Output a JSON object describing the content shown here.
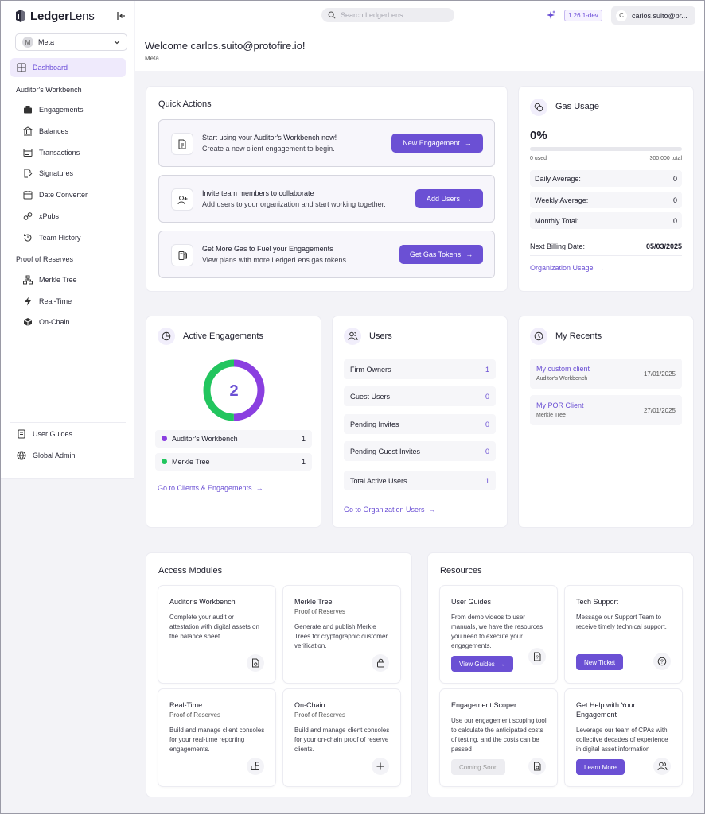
{
  "app": {
    "name_bold": "Ledger",
    "name_rest": "Lens"
  },
  "org_selector": {
    "initial": "M",
    "name": "Meta"
  },
  "nav": {
    "dashboard": "Dashboard",
    "section_auditor": "Auditor's Workbench",
    "auditor_items": [
      "Engagements",
      "Balances",
      "Transactions",
      "Signatures",
      "Date Converter",
      "xPubs",
      "Team History"
    ],
    "section_por": "Proof of Reserves",
    "por_items": [
      "Merkle Tree",
      "Real-Time",
      "On-Chain"
    ],
    "footer_items": [
      "User Guides",
      "Global Admin"
    ]
  },
  "topbar": {
    "search_placeholder": "Search LedgerLens",
    "version": "1.26.1-dev",
    "user_initial": "C",
    "user_email": "carlos.suito@pr..."
  },
  "welcome": {
    "title": "Welcome carlos.suito@protofire.io!",
    "subtitle": "Meta"
  },
  "quick_actions": {
    "title": "Quick Actions",
    "items": [
      {
        "title": "Start using your Auditor's Workbench now!",
        "desc": "Create a new client engagement to begin.",
        "button": "New Engagement"
      },
      {
        "title": "Invite team members to collaborate",
        "desc": "Add users to your organization and start working together.",
        "button": "Add Users"
      },
      {
        "title": "Get More Gas to Fuel your Engagements",
        "desc": "View plans with more LedgerLens gas tokens.",
        "button": "Get Gas Tokens"
      }
    ]
  },
  "gas": {
    "title": "Gas Usage",
    "percent": "0%",
    "progress_fraction": 0,
    "used": "0 used",
    "total": "300,000 total",
    "rows": [
      {
        "label": "Daily Average:",
        "value": "0"
      },
      {
        "label": "Weekly Average:",
        "value": "0"
      },
      {
        "label": "Monthly Total:",
        "value": "0"
      }
    ],
    "billing_label": "Next Billing Date:",
    "billing_value": "05/03/2025",
    "link": "Organization Usage"
  },
  "active_engagements": {
    "title": "Active Engagements",
    "total": "2",
    "rows": [
      {
        "label": "Auditor's Workbench",
        "value": "1",
        "color": "#8a3fe0"
      },
      {
        "label": "Merkle Tree",
        "value": "1",
        "color": "#22c55e"
      }
    ],
    "link": "Go to Clients & Engagements"
  },
  "users": {
    "title": "Users",
    "rows": [
      {
        "label": "Firm Owners",
        "value": "1"
      },
      {
        "label": "Guest Users",
        "value": "0"
      },
      {
        "label": "Pending Invites",
        "value": "0"
      },
      {
        "label": "Pending Guest Invites",
        "value": "0"
      },
      {
        "label": "Total Active Users",
        "value": "1"
      }
    ],
    "link": "Go to Organization Users"
  },
  "recents": {
    "title": "My Recents",
    "items": [
      {
        "name": "My custom client",
        "module": "Auditor's Workbench",
        "date": "17/01/2025"
      },
      {
        "name": "My POR Client",
        "module": "Merkle Tree",
        "date": "27/01/2025"
      }
    ]
  },
  "access_modules": {
    "title": "Access Modules",
    "items": [
      {
        "title": "Auditor's Workbench",
        "subtitle": "",
        "desc": "Complete your audit or attestation with digital assets on the balance sheet."
      },
      {
        "title": "Merkle Tree",
        "subtitle": "Proof of Reserves",
        "desc": "Generate and publish Merkle Trees for cryptographic customer verification."
      },
      {
        "title": "Real-Time",
        "subtitle": "Proof of Reserves",
        "desc": "Build and manage client consoles for your real-time reporting engagements."
      },
      {
        "title": "On-Chain",
        "subtitle": "Proof of Reserves",
        "desc": "Build and manage client consoles for your on-chain proof of reserve clients."
      }
    ]
  },
  "resources": {
    "title": "Resources",
    "items": [
      {
        "title": "User Guides",
        "desc": "From demo videos to user manuals, we have the resources you need to execute your engagements.",
        "button": "View Guides"
      },
      {
        "title": "Tech Support",
        "desc": "Message our Support Team to receive timely technical support.",
        "button": "New Ticket"
      },
      {
        "title": "Engagement Scoper",
        "desc": "Use our engagement scoping tool to calculate the anticipated costs of testing, and the costs can be passed",
        "button": "Coming Soon"
      },
      {
        "title": "Get Help with Your Engagement",
        "desc": "Leverage our team of CPAs with collective decades of experience in digital asset information",
        "button": "Learn More"
      }
    ]
  },
  "colors": {
    "accent": "#6b50d4",
    "donut_purple": "#8a3fe0",
    "donut_green": "#22c55e"
  }
}
